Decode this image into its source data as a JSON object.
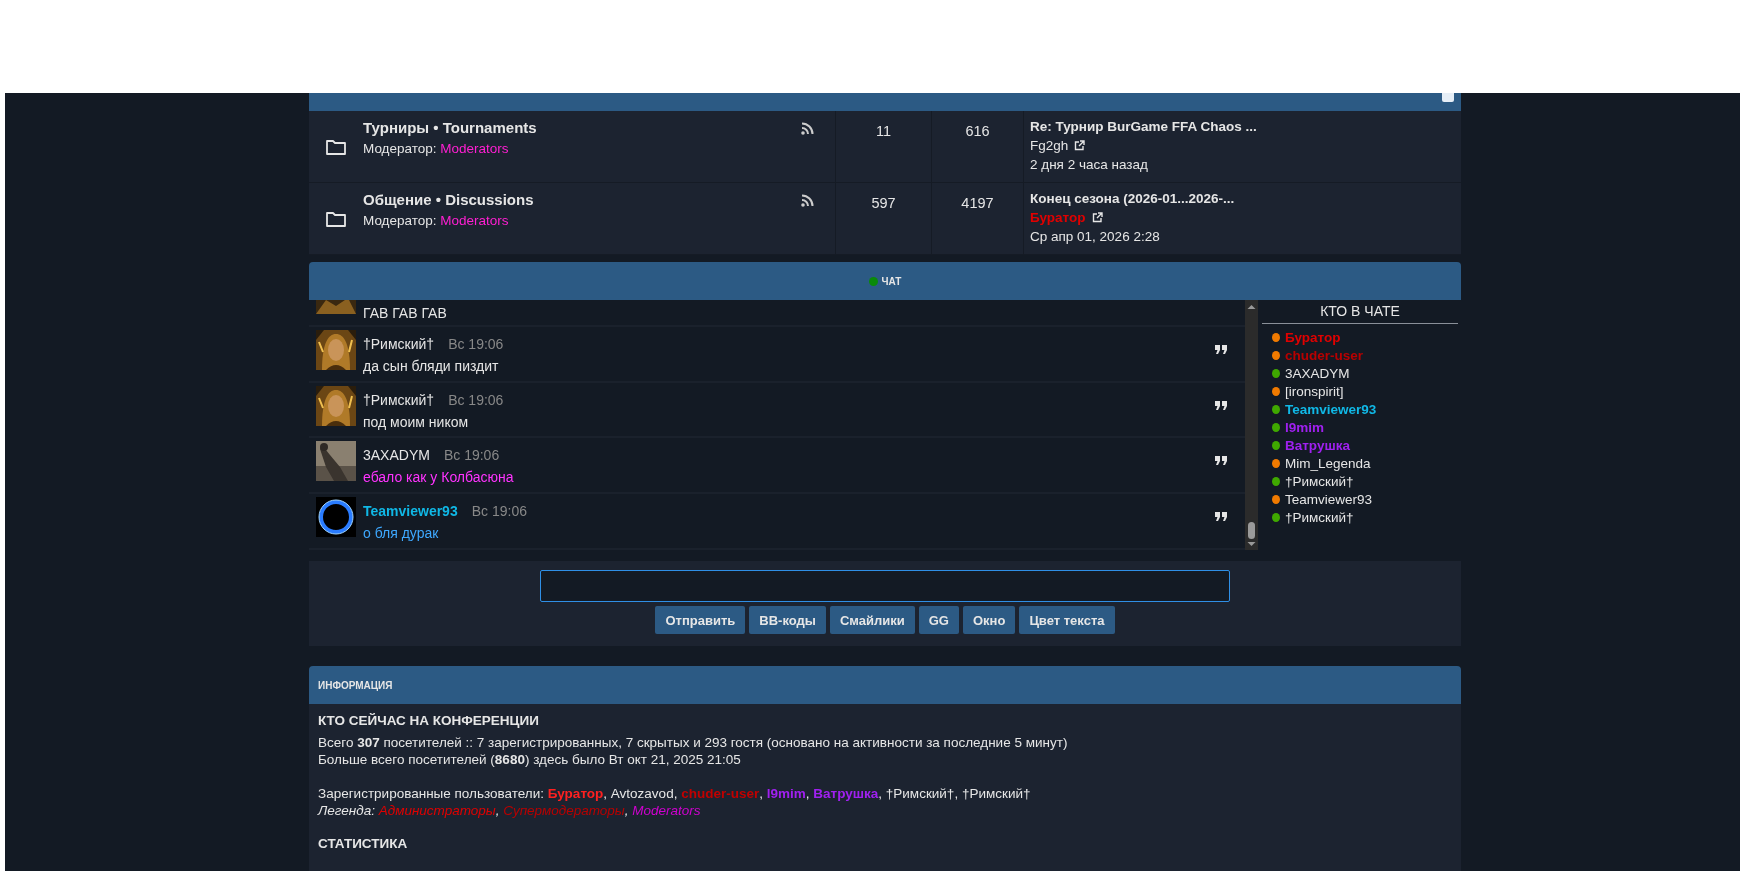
{
  "forums": [
    {
      "title": "Турниры • Tournaments",
      "moderator_label": "Модератор:",
      "moderator": "Moderators",
      "topics": "11",
      "posts": "616",
      "last_post": {
        "title": "Re: Турнир BurGame FFA Chaos ...",
        "author": "Fg2gh",
        "color": "#e6e6e6",
        "time": "2 дня 2 часа назад"
      }
    },
    {
      "title": "Общение • Discussions",
      "moderator_label": "Модератор:",
      "moderator": "Moderators",
      "topics": "597",
      "posts": "4197",
      "last_post": {
        "title": "Конец сезона (2026-01...2026-...",
        "author": "Буратор",
        "color": "#e00000",
        "time": "Ср апр 01, 2026 2:28"
      }
    }
  ],
  "chat": {
    "title": "ЧАТ",
    "messages": [
      {
        "kind": "cut",
        "text": "ГАВ ГАВ ГАВ",
        "color": "#e6e6e6"
      },
      {
        "kind": "full",
        "author": {
          "name": "†Римский†",
          "color": "#e6e6e6"
        },
        "time": "Вс 19:06",
        "text": "да сын бляди пиздит",
        "color": "#e6e6e6"
      },
      {
        "kind": "full",
        "author": {
          "name": "†Римский†",
          "color": "#e6e6e6"
        },
        "time": "Вс 19:06",
        "text": "под моим ником",
        "color": "#e6e6e6"
      },
      {
        "kind": "full",
        "author": {
          "name": "3AXADYM",
          "color": "#e6e6e6"
        },
        "time": "Вс 19:06",
        "text": "ебало как у Колбасюна",
        "color": "#ff33ff"
      },
      {
        "kind": "full",
        "author": {
          "name": "Teamviewer93",
          "color": "#10b8e6"
        },
        "time": "Вс 19:06",
        "text": "о бля дурак",
        "color": "#3ea8ff"
      }
    ],
    "who_title": "КТО В ЧАТЕ",
    "who": [
      {
        "name": "Буратор",
        "color": "#e00000",
        "bold": true,
        "dot": {
          "color": "#f07a00"
        }
      },
      {
        "name": "chuder-user",
        "color": "#b80000",
        "bold": true,
        "dot": {
          "color": "#f07a00"
        }
      },
      {
        "name": "3AXADYM",
        "color": "#e6e6e6",
        "bold": false,
        "dot": {
          "color": "#3fa800"
        }
      },
      {
        "name": "[ironspirit]",
        "color": "#e6e6e6",
        "bold": false,
        "dot": {
          "color": "#f07a00"
        }
      },
      {
        "name": "Teamviewer93",
        "color": "#10b8e6",
        "bold": true,
        "dot": {
          "color": "#3fa800"
        }
      },
      {
        "name": "l9mim",
        "color": "#a020f0",
        "bold": true,
        "dot": {
          "color": "#3fa800"
        }
      },
      {
        "name": "Ватрушка",
        "color": "#a020f0",
        "bold": true,
        "dot": {
          "color": "#3fa800"
        }
      },
      {
        "name": "Mim_Legenda",
        "color": "#e6e6e6",
        "bold": false,
        "dot": {
          "color": "#f07a00"
        }
      },
      {
        "name": "†Римский†",
        "color": "#e6e6e6",
        "bold": false,
        "dot": {
          "color": "#3fa800"
        }
      },
      {
        "name": "Teamviewer93",
        "color": "#e6e6e6",
        "bold": false,
        "dot": {
          "color": "#f07a00"
        }
      },
      {
        "name": "†Pимский†",
        "color": "#e6e6e6",
        "bold": false,
        "dot": {
          "color": "#3fa800"
        }
      }
    ],
    "buttons": [
      "Отправить",
      "BB-коды",
      "Смайлики",
      "GG",
      "Окно",
      "Цвет текста"
    ]
  },
  "info": {
    "title": "ИНФОРМАЦИЯ",
    "online_heading": "КТО СЕЙЧАС НА КОНФЕРЕНЦИИ",
    "lines": [
      "Всего **307** посетителей :: 7 зарегистрированных, 7 скрытых и 293 гостя (основано на активности за последние 5 минут)",
      "Больше всего посетителей (**8680**) здесь было Вт окт 21, 2025 21:05"
    ],
    "registered_label": "Зарегистрированные пользователи:",
    "separator": ",",
    "registered": [
      {
        "name": "Буратор",
        "color": "#ff2020",
        "bold": true
      },
      {
        "name": "Avtozavod",
        "color": "#e6e6e6",
        "bold": false
      },
      {
        "name": "chuder-user",
        "color": "#c00000",
        "bold": true
      },
      {
        "name": "l9mim",
        "color": "#a020f0",
        "bold": true
      },
      {
        "name": "Ватрушка",
        "color": "#a020f0",
        "bold": true
      },
      {
        "name": "†Pимский†",
        "color": "#e6e6e6",
        "bold": false
      },
      {
        "name": "†Римский†",
        "color": "#e6e6e6",
        "bold": false
      }
    ],
    "legend_label": "Легенда:",
    "legend": [
      {
        "name": "Администраторы",
        "color": "#e00000"
      },
      {
        "name": "Супермодераторы",
        "color": "#b80000"
      },
      {
        "name": "Moderators",
        "color": "#d000d0"
      }
    ],
    "stats_heading": "СТАТИСТИКА"
  }
}
